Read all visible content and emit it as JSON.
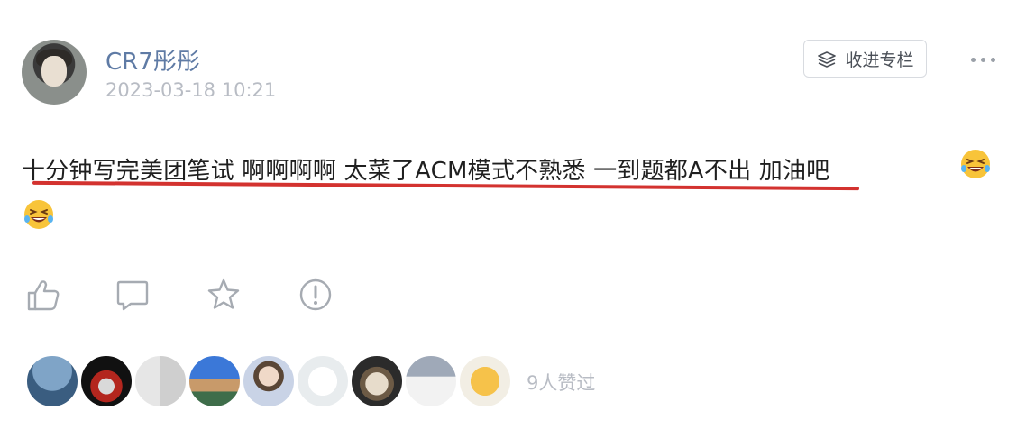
{
  "post": {
    "author": "CR7彤彤",
    "timestamp": "2023-03-18 10:21",
    "text": "十分钟写完美团笔试 啊啊啊啊 太菜了ACM模式不熟悉 一到题都A不出 加油吧",
    "emoji": [
      "grinning-squint-sweat-emoji",
      "grinning-squint-sweat-emoji"
    ]
  },
  "header": {
    "collect_label": "收进专栏"
  },
  "actions": [
    "like-icon",
    "comment-icon",
    "star-icon",
    "report-icon"
  ],
  "likes": {
    "count_label": "9人赞过",
    "avatar_count": 9
  },
  "colors": {
    "username": "#5f7ba5",
    "muted": "#b8bcc4",
    "underline": "#d3322f"
  }
}
